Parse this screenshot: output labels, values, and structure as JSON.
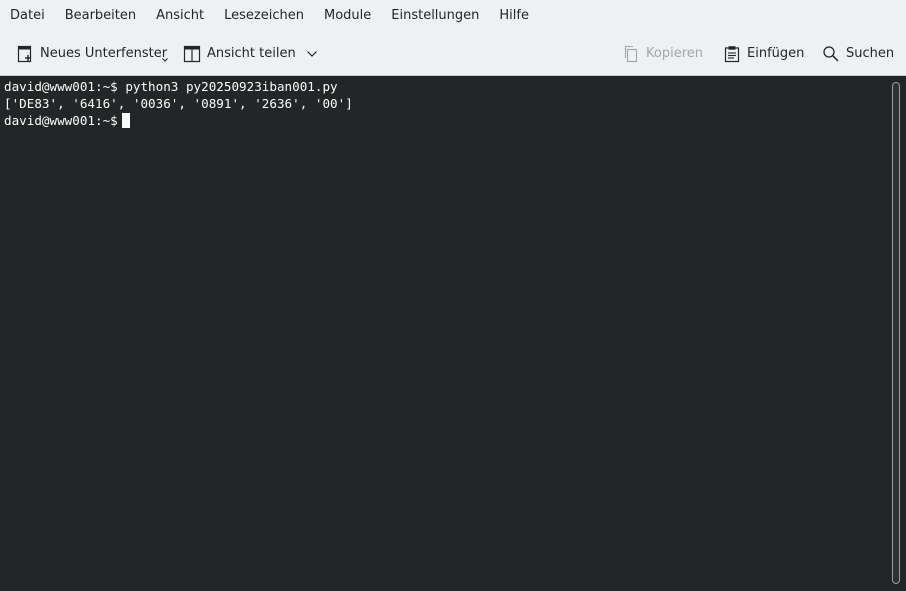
{
  "menubar": {
    "items": [
      "Datei",
      "Bearbeiten",
      "Ansicht",
      "Lesezeichen",
      "Module",
      "Einstellungen",
      "Hilfe"
    ]
  },
  "toolbar": {
    "new_tab": {
      "label": "Neues Unterfenster",
      "icon": "new-tab-icon"
    },
    "split_view": {
      "label": "Ansicht teilen",
      "icon": "split-view-icon"
    },
    "copy": {
      "label": "Kopieren",
      "icon": "copy-icon",
      "enabled": false
    },
    "paste": {
      "label": "Einfügen",
      "icon": "paste-icon"
    },
    "search": {
      "label": "Suchen",
      "icon": "search-icon"
    }
  },
  "terminal": {
    "lines": [
      "david@www001:~$ python3 py20250923iban001.py",
      "['DE83', '6416', '0036', '0891', '2636', '00']",
      "david@www001:~$"
    ]
  },
  "colors": {
    "chrome_bg": "#eff0f1",
    "terminal_bg": "#232627",
    "terminal_fg": "#fcfcfc",
    "disabled_text": "#a3a6a8"
  }
}
